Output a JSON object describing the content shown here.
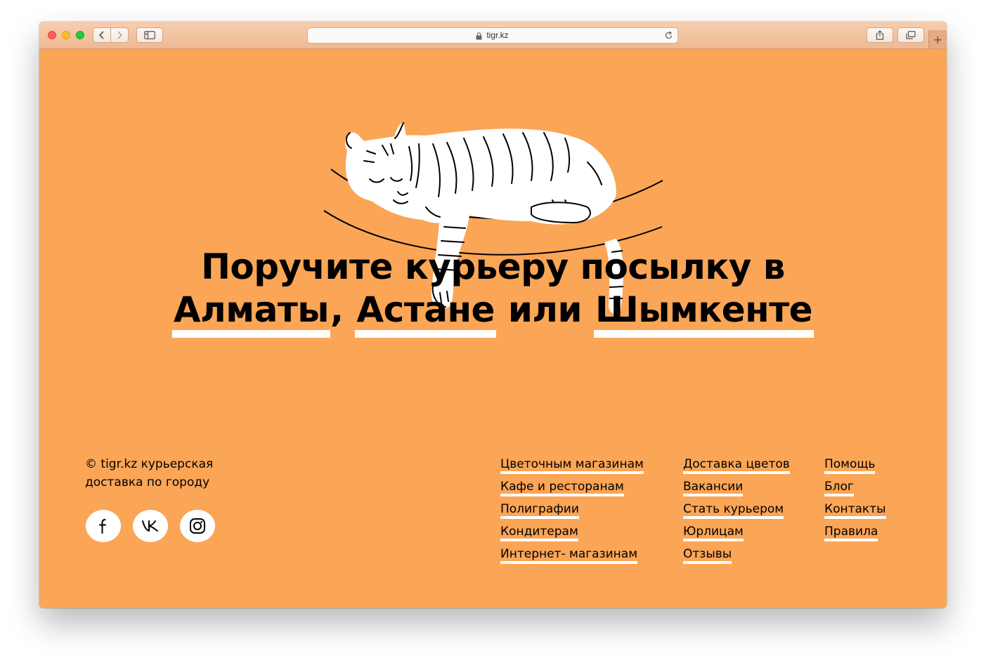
{
  "browser": {
    "url": "tigr.kz",
    "new_tab_label": "+"
  },
  "hero": {
    "line1": "Поручите курьеру посылку в",
    "city1": "Алматы",
    "sep1": ", ",
    "city2": "Астане",
    "sep2": " или ",
    "city3": "Шымкенте"
  },
  "footer": {
    "copyright": "© tigr.kz курьерская доставка по городу",
    "social": [
      "facebook-icon",
      "vk-icon",
      "instagram-icon"
    ],
    "col1": [
      "Цветочным магазинам",
      "Кафе и ресторанам",
      "Полиграфии",
      "Кондитерам",
      "Интернет- магазинам"
    ],
    "col2": [
      "Доставка цветов",
      "Вакансии",
      "Стать курьером",
      "Юрлицам",
      "Отзывы"
    ],
    "col3": [
      "Помощь",
      "Блог",
      "Контакты",
      "Правила"
    ]
  },
  "colors": {
    "background": "#FBA556",
    "underline": "#FFFFFF",
    "text": "#000000"
  }
}
